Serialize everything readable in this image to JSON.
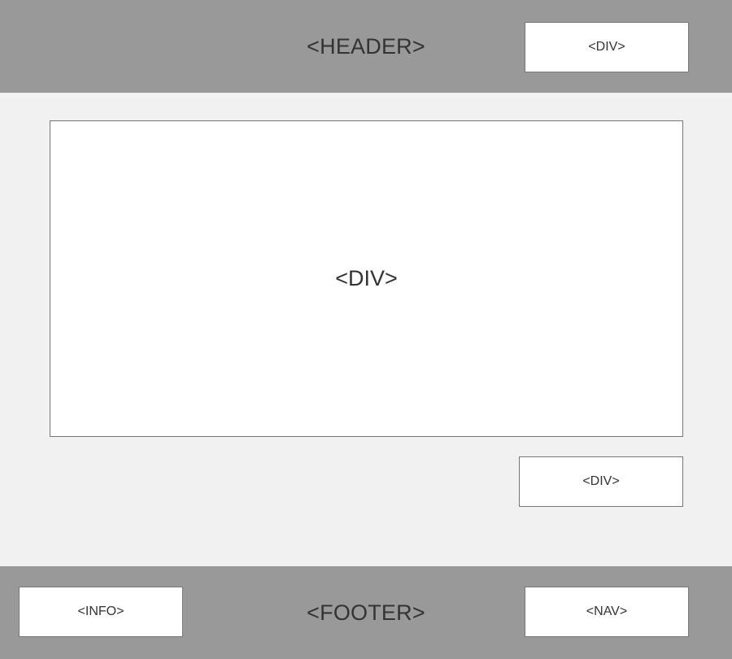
{
  "header": {
    "title": "<HEADER>",
    "div_label": "<DIV>"
  },
  "main": {
    "div_label": "<DIV>",
    "secondary_div_label": "<DIV>"
  },
  "footer": {
    "title": "<FOOTER>",
    "info_label": "<INFO>",
    "nav_label": "<NAV>"
  },
  "colors": {
    "band": "#999999",
    "background": "#f1f1f1",
    "box": "#ffffff",
    "border": "#777777",
    "text": "#333333"
  }
}
